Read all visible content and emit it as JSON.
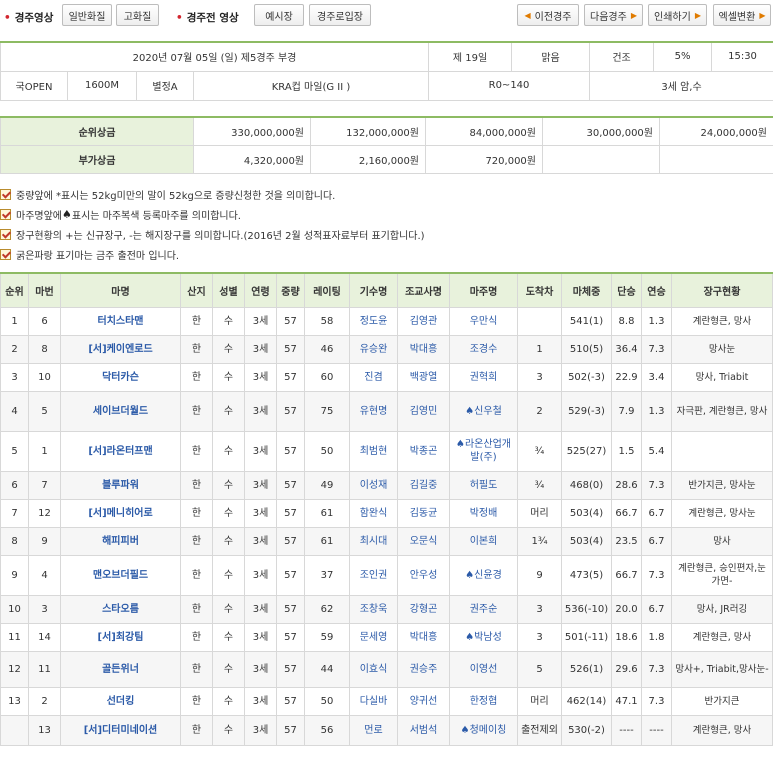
{
  "topbar": {
    "video_label": "경주영상",
    "normal_quality": "일반화질",
    "high_quality": "고화질",
    "prerace_label": "경주전 영상",
    "parade": "예시장",
    "entrance": "경주로입장",
    "prev_race": "이전경주",
    "next_race": "다음경주",
    "print": "인쇄하기",
    "excel": "엑셀변환"
  },
  "race_info": {
    "date_title": "2020년 07월 05일 (일) 제5경주 부경",
    "day": "제 19일",
    "weather": "맑음",
    "track": "건조",
    "moisture": "5%",
    "time": "15:30",
    "grade": "국OPEN",
    "distance": "1600M",
    "weight_type": "별정A",
    "race_name": "KRA컵 마일(G II )",
    "rating": "R0~140",
    "age_sex": "3세 암,수"
  },
  "prize": {
    "rank_label": "순위상금",
    "rank": [
      "330,000,000원",
      "132,000,000원",
      "84,000,000원",
      "30,000,000원",
      "24,000,000원"
    ],
    "bonus_label": "부가상금",
    "bonus": [
      "4,320,000원",
      "2,160,000원",
      "720,000원"
    ]
  },
  "notes": [
    "중량앞에 *표시는 52kg미만의 말이 52kg으로 증량신청한 것을 의미합니다.",
    "마주명앞에",
    "표시는 마주복색 등록마주를 의미합니다.",
    "장구현황의 +는 신규장구, -는 해지장구를 의미합니다.(2016년 2월 성적표자료부터 표기합니다.)",
    "굵은파랑 표기마는 금주 출전마 입니다."
  ],
  "results": {
    "headers": [
      "순위",
      "마번",
      "마명",
      "산지",
      "성별",
      "연령",
      "중량",
      "레이팅",
      "기수명",
      "조교사명",
      "마주명",
      "도착차",
      "마체중",
      "단승",
      "연승",
      "장구현황"
    ],
    "rows": [
      [
        "1",
        "6",
        "터치스타맨",
        "한",
        "수",
        "3세",
        "57",
        "58",
        "정도윤",
        "김영관",
        "우만식",
        "",
        "541(1)",
        "8.8",
        "1.3",
        "계란형큰, 망사"
      ],
      [
        "2",
        "8",
        "[서]케이엔로드",
        "한",
        "수",
        "3세",
        "57",
        "46",
        "유승완",
        "박대흥",
        "조경수",
        "1",
        "510(5)",
        "36.4",
        "7.3",
        "망사눈"
      ],
      [
        "3",
        "10",
        "닥터카슨",
        "한",
        "수",
        "3세",
        "57",
        "60",
        "진겸",
        "백광열",
        "권혁희",
        "3",
        "502(-3)",
        "22.9",
        "3.4",
        "망사, Triabit"
      ],
      [
        "4",
        "5",
        "세이브더월드",
        "한",
        "수",
        "3세",
        "57",
        "75",
        "유현명",
        "김영민",
        "♠신우철",
        "2",
        "529(-3)",
        "7.9",
        "1.3",
        "자극판, 계란형큰, 망사"
      ],
      [
        "5",
        "1",
        "[서]라온터프맨",
        "한",
        "수",
        "3세",
        "57",
        "50",
        "최범현",
        "박종곤",
        "♠라온산업개발(주)",
        "¾",
        "525(27)",
        "1.5",
        "5.4",
        ""
      ],
      [
        "6",
        "7",
        "블루파워",
        "한",
        "수",
        "3세",
        "57",
        "49",
        "이성재",
        "김길중",
        "허필도",
        "¾",
        "468(0)",
        "28.6",
        "7.3",
        "반가지큰, 망사눈"
      ],
      [
        "7",
        "12",
        "[서]메니히어로",
        "한",
        "수",
        "3세",
        "57",
        "61",
        "함완식",
        "김동균",
        "박정배",
        "머리",
        "503(4)",
        "66.7",
        "6.7",
        "계란형큰, 망사눈"
      ],
      [
        "8",
        "9",
        "해피피버",
        "한",
        "수",
        "3세",
        "57",
        "61",
        "최시대",
        "오문식",
        "이본희",
        "1¾",
        "503(4)",
        "23.5",
        "6.7",
        "망사"
      ],
      [
        "9",
        "4",
        "맨오브더필드",
        "한",
        "수",
        "3세",
        "57",
        "37",
        "조인권",
        "안우성",
        "♠신윤경",
        "9",
        "473(5)",
        "66.7",
        "7.3",
        "계란형큰, 승인편자,눈가면-"
      ],
      [
        "10",
        "3",
        "스타오름",
        "한",
        "수",
        "3세",
        "57",
        "62",
        "조창욱",
        "강형곤",
        "권주순",
        "3",
        "536(-10)",
        "20.0",
        "6.7",
        "망사, JR러깅"
      ],
      [
        "11",
        "14",
        "[서]최강팀",
        "한",
        "수",
        "3세",
        "57",
        "59",
        "문세영",
        "박대흥",
        "♠박남성",
        "3",
        "501(-11)",
        "18.6",
        "1.8",
        "계란형큰, 망사"
      ],
      [
        "12",
        "11",
        "골든위너",
        "한",
        "수",
        "3세",
        "57",
        "44",
        "이효식",
        "권승주",
        "이영선",
        "5",
        "526(1)",
        "29.6",
        "7.3",
        "망사+, Triabit,망사눈-"
      ],
      [
        "13",
        "2",
        "선더킹",
        "한",
        "수",
        "3세",
        "57",
        "50",
        "다실바",
        "양귀선",
        "한정협",
        "머리",
        "462(14)",
        "47.1",
        "7.3",
        "반가지큰"
      ],
      [
        "",
        "13",
        "[서]디터미네이션",
        "한",
        "수",
        "3세",
        "57",
        "56",
        "먼로",
        "서범석",
        "♠청메이칭",
        "출전제외",
        "530(-2)",
        "----",
        "----",
        "계란형큰, 망사"
      ]
    ]
  }
}
